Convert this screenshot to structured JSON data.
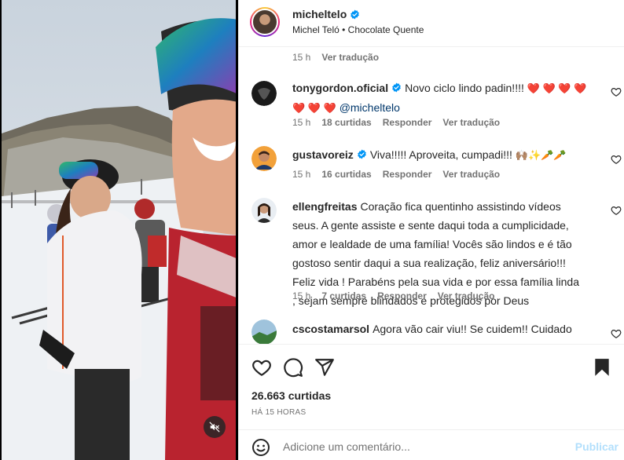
{
  "post": {
    "username": "micheltelo",
    "subtitle": "Michel Teló • Chocolate Quente"
  },
  "caption_meta": {
    "time": "15 h",
    "translate": "Ver tradução"
  },
  "comments": [
    {
      "username": "tonygordon.oficial",
      "text": "Novo ciclo lindo padin!!!! ❤️❤️❤️❤️ ❤️❤️❤️",
      "text_main": "Novo ciclo lindo padin!!!!",
      "hearts_line1": "❤️ ❤️ ❤️ ❤️",
      "hearts_line2": "❤️ ❤️ ❤️",
      "mention": "@micheltelo",
      "time": "15 h",
      "likes": "18 curtidas",
      "reply": "Responder",
      "translate": "Ver tradução",
      "verified": true
    },
    {
      "username": "gustavoreiz",
      "text": "Viva!!!!! Aproveita, cumpadi!!! 🙌🏽✨🥕🥕",
      "text_main": "Viva!!!!! Aproveita, cumpadi!!!",
      "emojis": "🙌🏽✨🥕🥕",
      "time": "15 h",
      "likes": "16 curtidas",
      "reply": "Responder",
      "translate": "Ver tradução",
      "verified": true
    },
    {
      "username": "ellengfreitas",
      "text": "Coração fica quentinho assistindo vídeos seus. A gente assiste e sente daqui toda a cumplicidade, amor e lealdade de uma família! Vocês são lindos e é tão gostoso sentir daqui a sua realização, feliz aniversário!!! Feliz vida ! Parabéns pela sua vida e por essa família linda , sejam sempre blindados e protegidos por Deus",
      "time": "15 h",
      "likes": "7 curtidas",
      "reply": "Responder",
      "translate": "Ver tradução",
      "verified": false
    },
    {
      "username": "cscostamarsol",
      "text": "Agora vão cair viu!! Se cuidem!! Cuidado com as",
      "verified": false
    }
  ],
  "actions": {
    "like_icon": "heart-icon",
    "comment_icon": "comment-icon",
    "share_icon": "send-icon",
    "save_icon": "bookmark-icon",
    "likes_count": "26.663 curtidas",
    "time_ago": "HÁ 15 HORAS"
  },
  "add_comment": {
    "placeholder": "Adicione um comentário...",
    "post_label": "Publicar"
  },
  "colors": {
    "verified": "#0095f6",
    "post_button_disabled": "#b2dffc",
    "secondary_text": "#737373",
    "mention": "#00376b"
  }
}
